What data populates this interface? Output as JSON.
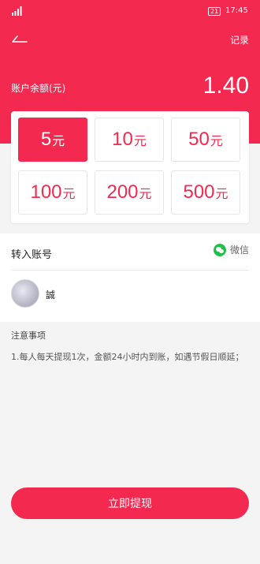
{
  "status_bar": {
    "battery": "21",
    "time": "17:45"
  },
  "header": {
    "records_label": "记录"
  },
  "balance": {
    "label": "账户余额(元)",
    "value": "1.40"
  },
  "amount_options": [
    {
      "num": "5",
      "unit": "元",
      "selected": true
    },
    {
      "num": "10",
      "unit": "元",
      "selected": false
    },
    {
      "num": "50",
      "unit": "元",
      "selected": false
    },
    {
      "num": "100",
      "unit": "元",
      "selected": false
    },
    {
      "num": "200",
      "unit": "元",
      "selected": false
    },
    {
      "num": "500",
      "unit": "元",
      "selected": false
    }
  ],
  "transfer": {
    "label": "转入账号",
    "method_label": "微信",
    "nickname": "誠"
  },
  "notes": {
    "title": "注意事项",
    "text": "1.每人每天提现1次，金额24小时内到账，如遇节假日顺延；"
  },
  "actions": {
    "withdraw_label": "立即提现"
  },
  "colors": {
    "accent": "#f4294f",
    "wechat": "#22c04b"
  }
}
